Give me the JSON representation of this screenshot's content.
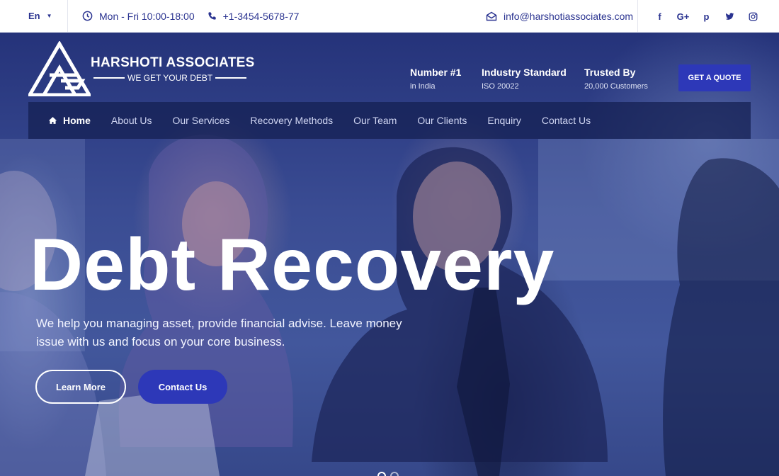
{
  "topbar": {
    "language": "En",
    "hours": "Mon - Fri 10:00-18:00",
    "phone": "+1-3454-5678-77",
    "email": "info@harshotiassociates.com",
    "socials": [
      {
        "icon": "facebook-icon",
        "glyph": "f"
      },
      {
        "icon": "google-plus-icon",
        "glyph": "G+"
      },
      {
        "icon": "pinterest-icon",
        "glyph": "p"
      },
      {
        "icon": "twitter-icon",
        "glyph": "t"
      },
      {
        "icon": "instagram-icon",
        "glyph": "ig"
      }
    ]
  },
  "brand": {
    "name": "HARSHOTI ASSOCIATES",
    "tagline": "WE GET YOUR DEBT"
  },
  "stats": [
    {
      "title": "Number #1",
      "sub": "in India"
    },
    {
      "title": "Industry Standard",
      "sub": "ISO 20022"
    },
    {
      "title": "Trusted By",
      "sub": "20,000 Customers"
    }
  ],
  "cta": {
    "quote": "GET A QUOTE"
  },
  "nav": {
    "items": [
      {
        "label": "Home",
        "active": true
      },
      {
        "label": "About Us"
      },
      {
        "label": "Our Services"
      },
      {
        "label": "Recovery Methods"
      },
      {
        "label": "Our Team"
      },
      {
        "label": "Our Clients"
      },
      {
        "label": "Enquiry"
      },
      {
        "label": "Contact Us"
      }
    ]
  },
  "hero": {
    "headline": "Debt Recovery",
    "subtext": "We help you managing asset, provide financial advise. Leave money issue with us and focus on your core business.",
    "learn_more": "Learn More",
    "contact_us": "Contact Us"
  },
  "colors": {
    "accent": "#2d38b8",
    "topbar_text": "#2a3390",
    "hero_overlay": "#25337a"
  }
}
